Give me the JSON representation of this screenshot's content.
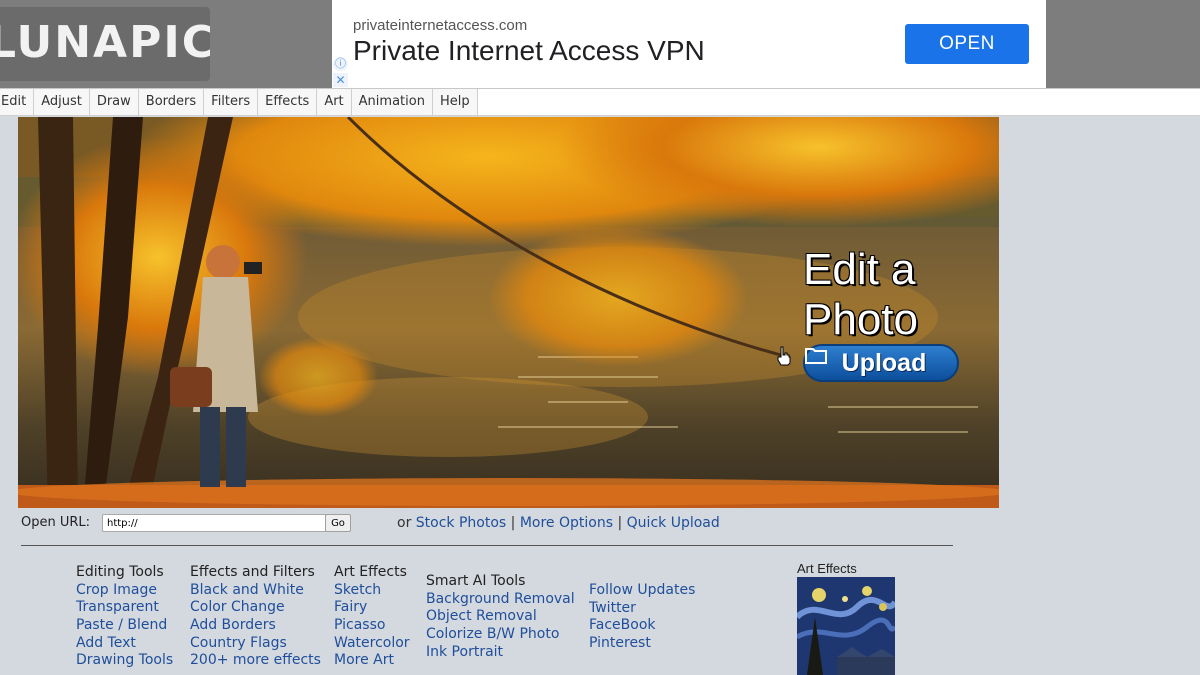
{
  "logo": {
    "text": "LUNAPIC"
  },
  "ad": {
    "domain": "privateinternetaccess.com",
    "title": "Private Internet Access VPN",
    "cta": "OPEN",
    "info_glyph": "ⓘ",
    "close_glyph": "✕",
    "cta_color": "#1a73e8"
  },
  "menu": {
    "items": [
      "Edit",
      "Adjust",
      "Draw",
      "Borders",
      "Filters",
      "Effects",
      "Art",
      "Animation",
      "Help"
    ]
  },
  "hero": {
    "title": "Edit a Photo",
    "upload_label": "Upload",
    "upload_icon": "folder-icon"
  },
  "url_bar": {
    "label": "Open URL:",
    "value": "http://",
    "go_label": "Go"
  },
  "links": {
    "prefix": "or ",
    "stock_photos": "Stock Photos",
    "sep1": " | ",
    "more_options": "More Options",
    "sep2": " | ",
    "quick_upload": "Quick Upload"
  },
  "columns": {
    "editing": {
      "heading": "Editing Tools",
      "items": [
        "Crop Image",
        "Transparent",
        "Paste / Blend",
        "Add Text",
        "Drawing Tools"
      ]
    },
    "effects": {
      "heading": "Effects and Filters",
      "items": [
        "Black and White",
        "Color Change",
        "Add Borders",
        "Country Flags",
        "200+ more effects"
      ]
    },
    "art": {
      "heading": "Art Effects",
      "items": [
        "Sketch",
        "Fairy",
        "Picasso",
        "Watercolor",
        "More Art"
      ]
    },
    "smart": {
      "heading": "Smart AI Tools",
      "items": [
        "Background Removal",
        "Object Removal",
        "Colorize B/W Photo",
        "Ink Portrait"
      ]
    },
    "follow": {
      "heading": "Follow Updates",
      "items": [
        "Twitter",
        "FaceBook",
        "Pinterest"
      ]
    }
  },
  "art_thumb": {
    "label": "Art Effects"
  },
  "colors": {
    "link": "#1f4f9a",
    "upload_button": "#0d4f9c"
  }
}
